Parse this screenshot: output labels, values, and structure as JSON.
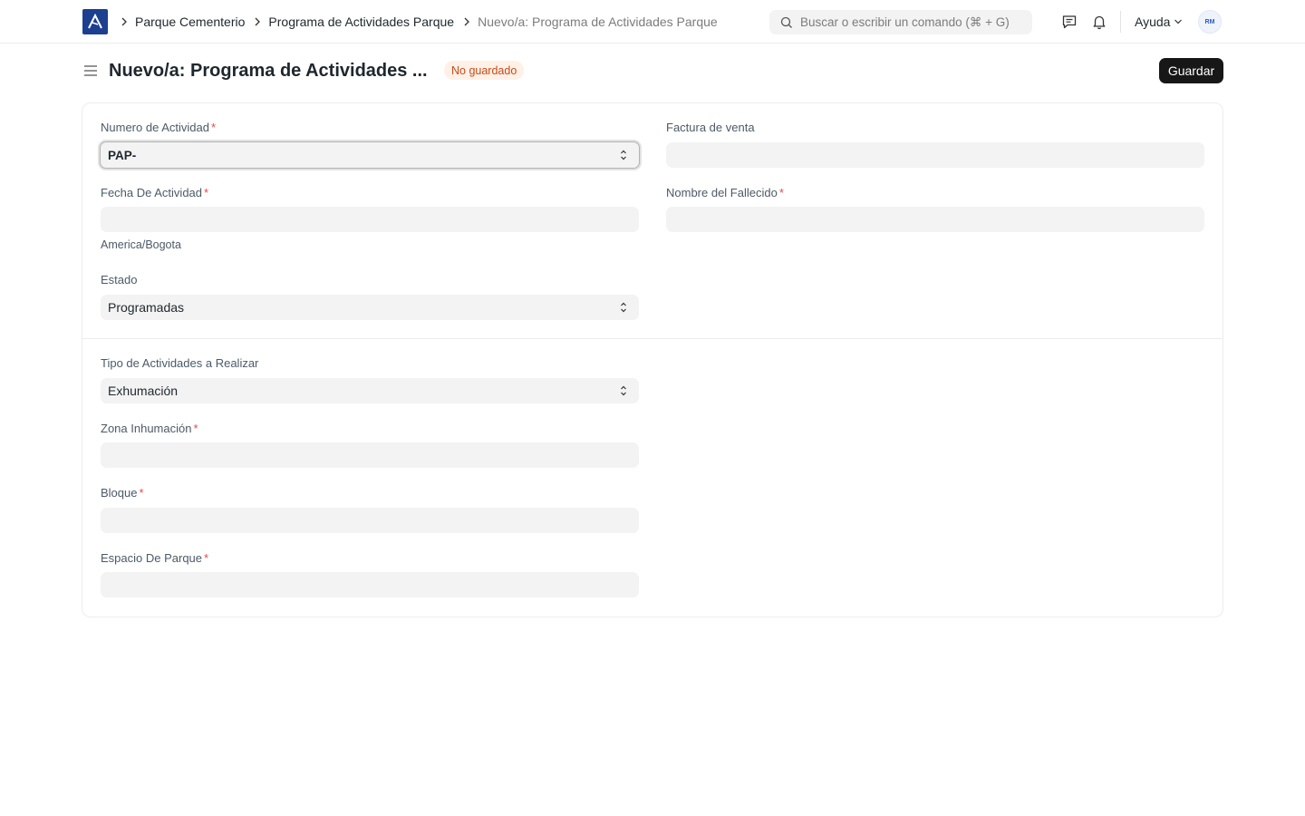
{
  "navbar": {
    "breadcrumbs": [
      "Parque Cementerio",
      "Programa de Actividades Parque",
      "Nuevo/a: Programa de Actividades Parque"
    ],
    "search_placeholder": "Buscar o escribir un comando (⌘ + G)",
    "help_label": "Ayuda",
    "avatar_initials": "RM"
  },
  "page": {
    "title": "Nuevo/a: Programa de Actividades ...",
    "status": "No guardado",
    "save_label": "Guardar"
  },
  "form": {
    "numero_actividad": {
      "label": "Numero de Actividad",
      "value": "PAP-"
    },
    "factura_venta": {
      "label": "Factura de venta",
      "value": ""
    },
    "fecha_actividad": {
      "label": "Fecha De Actividad",
      "value": "",
      "timezone": "America/Bogota"
    },
    "nombre_fallecido": {
      "label": "Nombre del Fallecido",
      "value": ""
    },
    "estado": {
      "label": "Estado",
      "value": "Programadas"
    },
    "tipo_actividades": {
      "label": "Tipo de Actividades a Realizar",
      "value": "Exhumación"
    },
    "zona_inhumacion": {
      "label": "Zona Inhumación",
      "value": ""
    },
    "bloque": {
      "label": "Bloque",
      "value": ""
    },
    "espacio_parque": {
      "label": "Espacio De Parque",
      "value": ""
    }
  },
  "colors": {
    "brand": "#1d3f8f",
    "badge_bg": "#fff1e7",
    "badge_text": "#cb4a18",
    "required": "#e24c4c",
    "primary_button": "#171717"
  }
}
